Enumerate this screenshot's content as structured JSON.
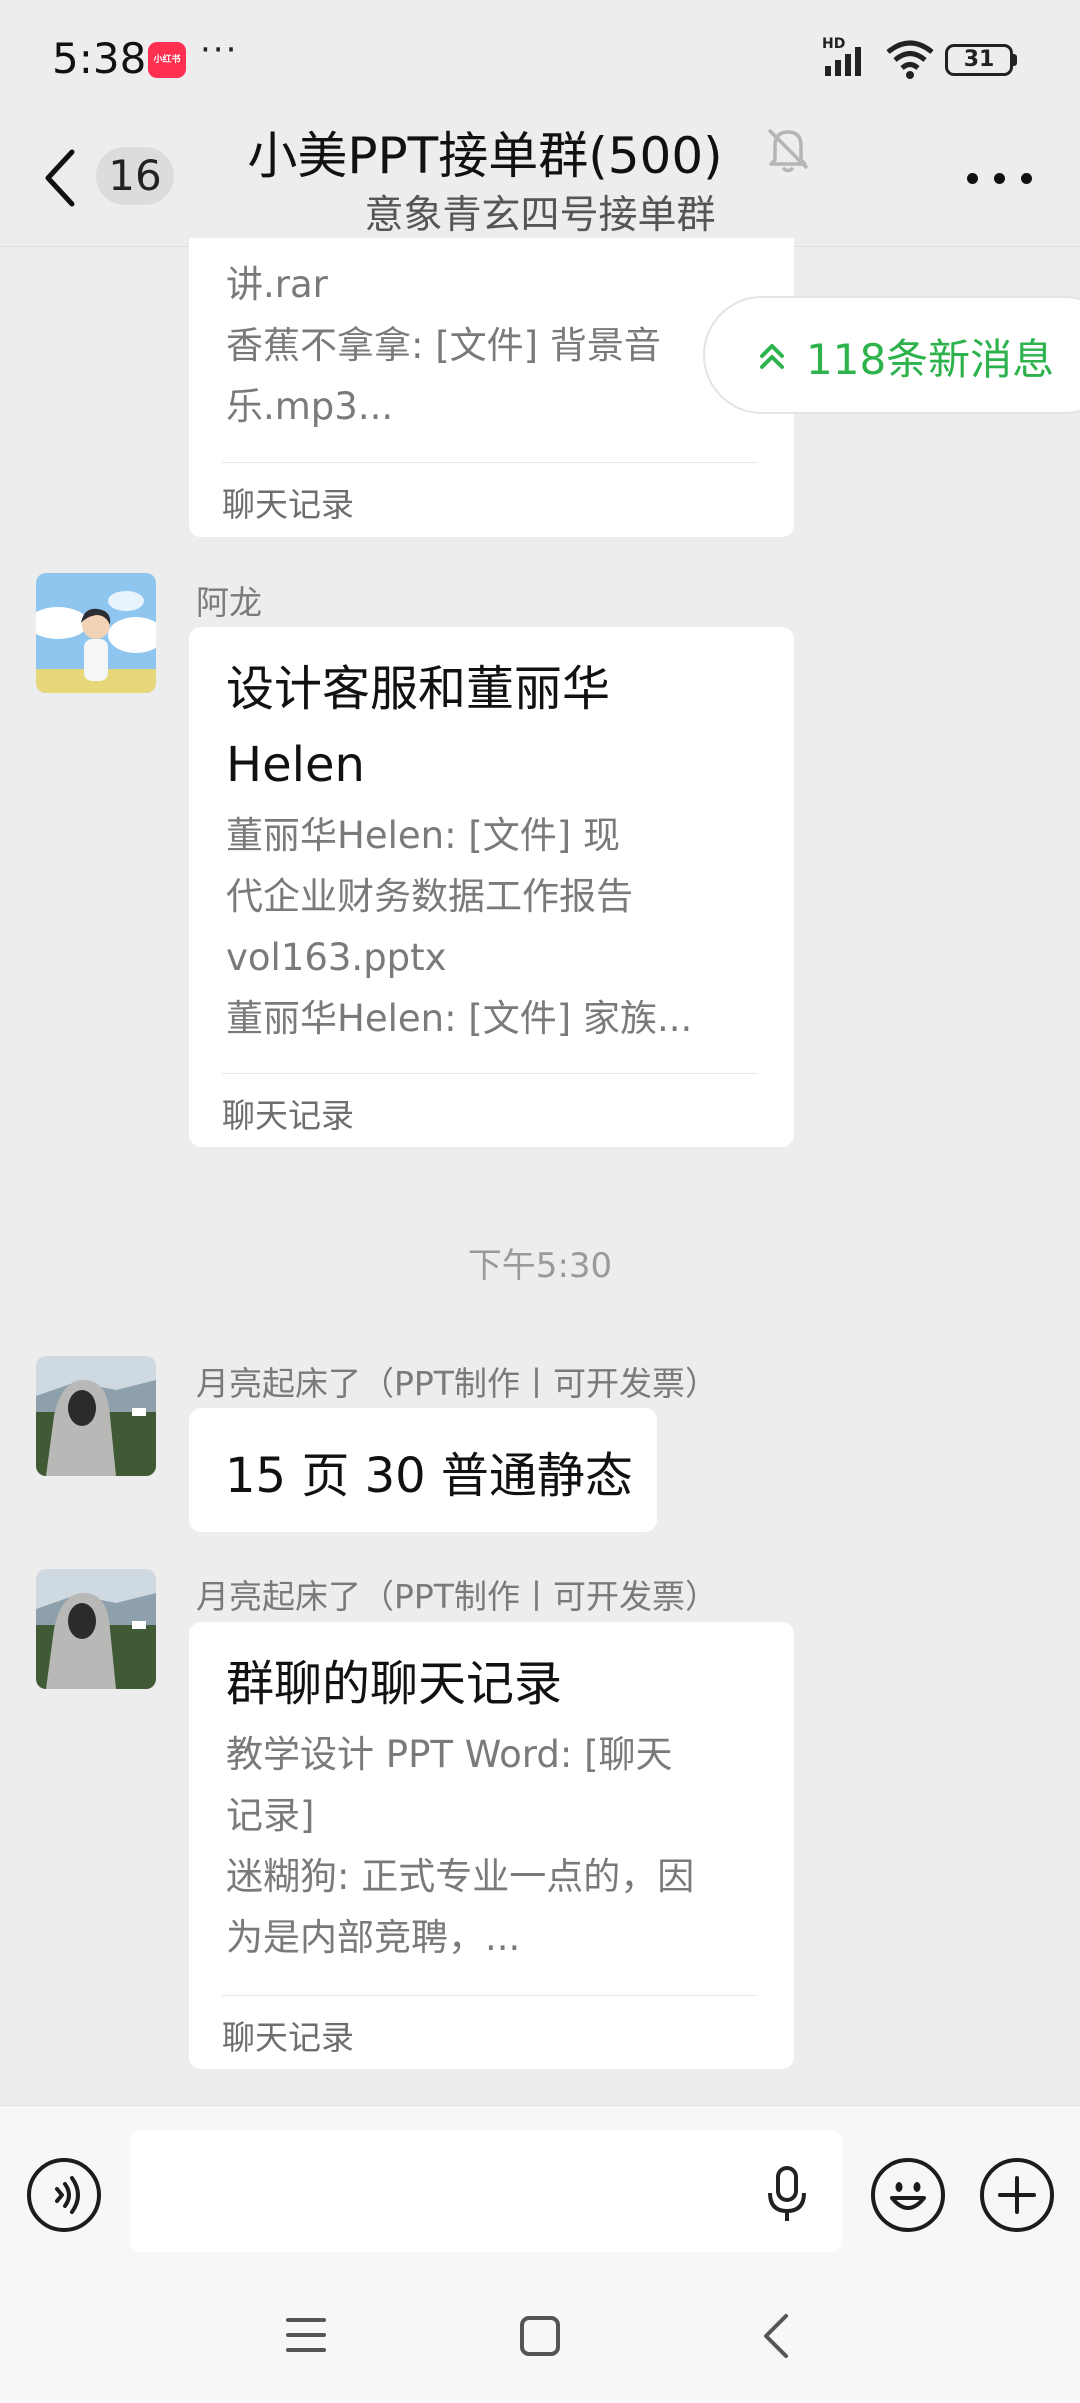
{
  "status_bar": {
    "time": "5:38",
    "app_badge": "小红书",
    "dots": "···",
    "network": "HD",
    "battery": "31"
  },
  "header": {
    "back_count": "16",
    "title": "小美PPT接单群(500)",
    "subtitle": "意象青玄四号接单群"
  },
  "new_messages": {
    "label": "118条新消息"
  },
  "messages": [
    {
      "type": "chat-record",
      "lines": [
        "讲.rar",
        "香蕉不拿拿: [文件] 背景音",
        "乐.mp3..."
      ],
      "footer": "聊天记录"
    },
    {
      "type": "chat-record",
      "sender": "阿龙",
      "title_lines": [
        "设计客服和董丽华",
        "Helen"
      ],
      "lines": [
        "董丽华Helen: [文件] 现",
        "代企业财务数据工作报告",
        "vol163.pptx",
        "董丽华Helen: [文件] 家族..."
      ],
      "footer": "聊天记录"
    },
    {
      "type": "time",
      "text": "下午5:30"
    },
    {
      "type": "text",
      "sender": "月亮起床了（PPT制作丨可开发票）",
      "text": "15 页 30 普通静态"
    },
    {
      "type": "chat-record",
      "sender": "月亮起床了（PPT制作丨可开发票）",
      "title_lines": [
        "群聊的聊天记录"
      ],
      "lines": [
        "教学设计 PPT  Word: [聊天",
        "记录]",
        "迷糊狗: 正式专业一点的，因",
        "为是内部竞聘，..."
      ],
      "footer": "聊天记录"
    }
  ],
  "colors": {
    "background": "#ededed",
    "accent_green": "#2db24c",
    "bubble": "#ffffff"
  },
  "icons": [
    "voice-icon",
    "microphone-icon",
    "emoji-icon",
    "plus-icon",
    "mute-bell-icon",
    "more-icon",
    "back-chevron-icon",
    "menu-icon",
    "home-icon",
    "back-nav-icon"
  ]
}
